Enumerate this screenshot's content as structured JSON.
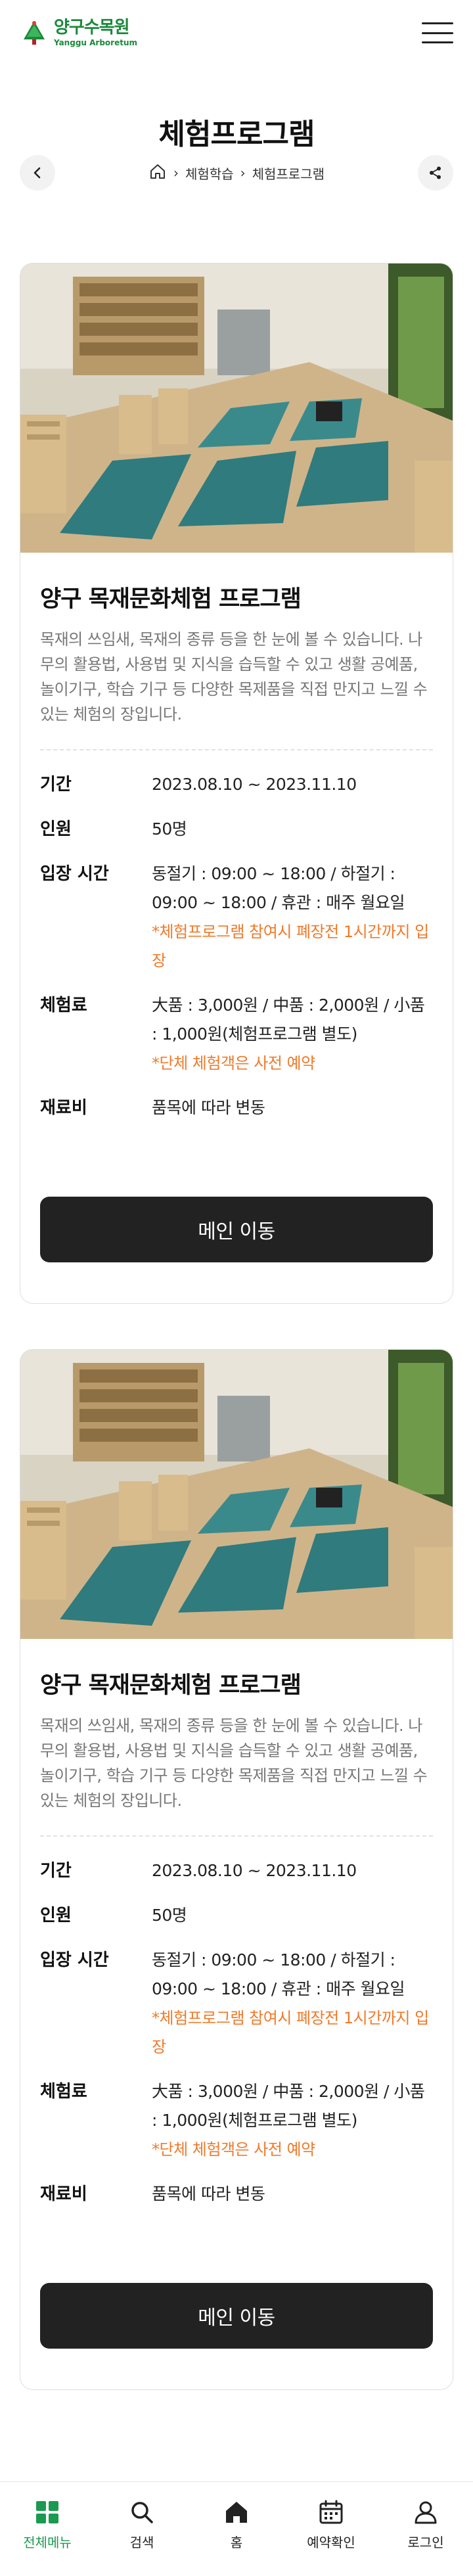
{
  "header": {
    "logo_ko": "양구수목원",
    "logo_en": "Yanggu Arboretum"
  },
  "page": {
    "title": "체험프로그램"
  },
  "breadcrumb": {
    "items": [
      "체험학습",
      "체험프로그램"
    ]
  },
  "cards": [
    {
      "title": "양구 목재문화체험 프로그램",
      "desc": "목재의 쓰임새, 목재의 종류 등을 한 눈에 볼 수 있습니다. 나무의 활용법, 사용법 및 지식을 습득할 수 있고 생활 공예품, 놀이기구, 학습 기구 등 다양한 목제품을 직접 만지고 느낄 수 있는 체험의 장입니다.",
      "rows": [
        {
          "label": "기간",
          "value": "2023.08.10 ~ 2023.11.10",
          "note": ""
        },
        {
          "label": "인원",
          "value": "50명",
          "note": ""
        },
        {
          "label": "입장 시간",
          "value": "동절기 : 09:00 ~ 18:00 / 하절기 : 09:00 ~ 18:00 / 휴관 : 매주 월요일",
          "note": "*체험프로그램 참여시 폐장전 1시간까지 입장"
        },
        {
          "label": "체험료",
          "value": "大품 : 3,000원 / 中품 : 2,000원 / 小품 : 1,000원(체험프로그램 별도)",
          "note": "*단체 체험객은 사전 예약"
        },
        {
          "label": "재료비",
          "value": "품목에 따라 변동",
          "note": ""
        }
      ],
      "button": "메인 이동"
    },
    {
      "title": "양구 목재문화체험 프로그램",
      "desc": "목재의 쓰임새, 목재의 종류 등을 한 눈에 볼 수 있습니다. 나무의 활용법, 사용법 및 지식을 습득할 수 있고 생활 공예품, 놀이기구, 학습 기구 등 다양한 목제품을 직접 만지고 느낄 수 있는 체험의 장입니다.",
      "rows": [
        {
          "label": "기간",
          "value": "2023.08.10 ~ 2023.11.10",
          "note": ""
        },
        {
          "label": "인원",
          "value": "50명",
          "note": ""
        },
        {
          "label": "입장 시간",
          "value": "동절기 : 09:00 ~ 18:00 / 하절기 : 09:00 ~ 18:00 / 휴관 : 매주 월요일",
          "note": "*체험프로그램 참여시 폐장전 1시간까지 입장"
        },
        {
          "label": "체험료",
          "value": "大품 : 3,000원 / 中품 : 2,000원 / 小품 : 1,000원(체험프로그램 별도)",
          "note": "*단체 체험객은 사전 예약"
        },
        {
          "label": "재료비",
          "value": "품목에 따라 변동",
          "note": ""
        }
      ],
      "button": "메인 이동"
    }
  ],
  "nav": [
    {
      "label": "전체메뉴",
      "icon": "grid-icon",
      "active": true
    },
    {
      "label": "검색",
      "icon": "search-icon",
      "active": false
    },
    {
      "label": "홈",
      "icon": "home-icon",
      "active": false
    },
    {
      "label": "예약확인",
      "icon": "calendar-icon",
      "active": false
    },
    {
      "label": "로그인",
      "icon": "user-icon",
      "active": false
    }
  ],
  "colors": {
    "brand": "#1a8a3a",
    "accent_note": "#f07a2a",
    "button_dark": "#222222",
    "nav_active": "#1a9a50"
  }
}
